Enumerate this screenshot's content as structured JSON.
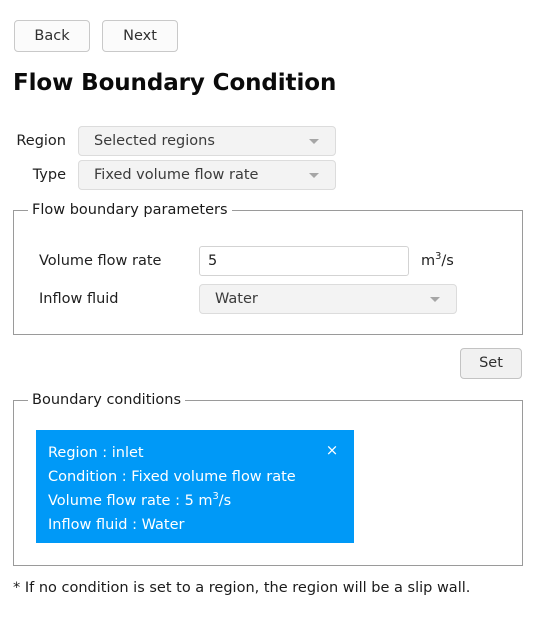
{
  "nav": {
    "back_label": "Back",
    "next_label": "Next"
  },
  "page_title": "Flow Boundary Condition",
  "form": {
    "region": {
      "label": "Region",
      "value": "Selected regions"
    },
    "type": {
      "label": "Type",
      "value": "Fixed volume flow rate"
    }
  },
  "parameters_group": {
    "title": "Flow boundary parameters",
    "volume_flow_rate": {
      "label": "Volume flow rate",
      "value": "5",
      "unit_base": "m",
      "unit_exponent": "3",
      "unit_suffix": "/s"
    },
    "inflow_fluid": {
      "label": "Inflow fluid",
      "value": "Water"
    }
  },
  "set_button_label": "Set",
  "conditions_group": {
    "title": "Boundary conditions",
    "card": {
      "region_line": "Region : inlet",
      "condition_line": "Condition : Fixed volume flow rate",
      "flow_rate_prefix": "Volume flow rate : 5 m",
      "flow_rate_exponent": "3",
      "flow_rate_suffix": "/s",
      "fluid_line": "Inflow fluid : Water",
      "close_label": "×",
      "color": "#0099f7"
    }
  },
  "footnote": "* If no condition is set to a region, the region will be a slip wall."
}
